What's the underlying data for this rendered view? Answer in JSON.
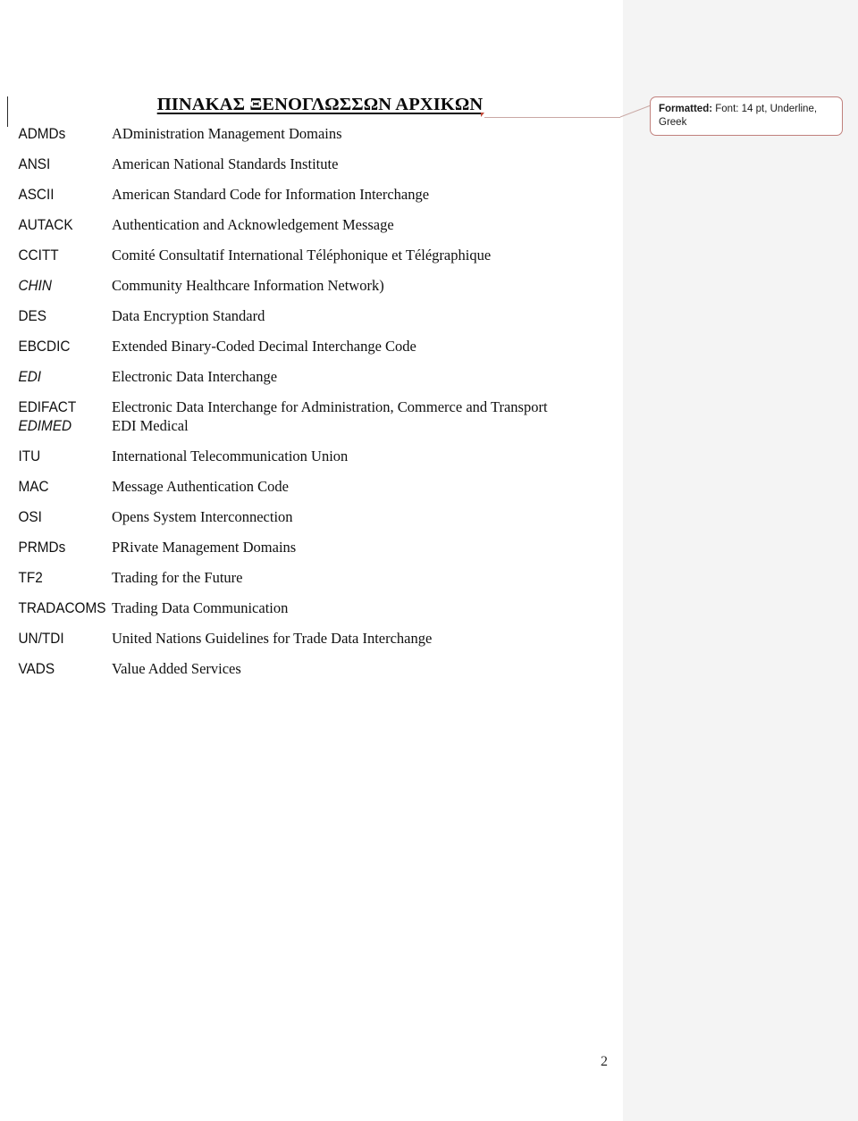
{
  "page": {
    "title": "ΠΙΝΑΚΑΣ ΞΕΝΟΓΛΩΣΣΩΝ ΑΡΧΙΚΩΝ",
    "number": "2",
    "sheet_color": "#ffffff",
    "margin_color": "#f4f4f4"
  },
  "comment": {
    "label": "Formatted:",
    "text": " Font: 14 pt, Underline, Greek",
    "border_color": "#c0807c",
    "anchor_color": "#c24a3a"
  },
  "glossary": {
    "rows": [
      {
        "abbr": "ADMDs",
        "italic": false,
        "definition": "ADministration Management Domains"
      },
      {
        "abbr": "ANSI",
        "italic": false,
        "definition": "American National Standards Institute"
      },
      {
        "abbr": "ASCII",
        "italic": false,
        "definition": "American Standard Code for Information Interchange"
      },
      {
        "abbr": "AUTACK",
        "italic": false,
        "definition": "Authentication and Acknowledgement Message"
      },
      {
        "abbr": "CCITT",
        "italic": false,
        "definition": "Comité Consultatif International Téléphonique et Télégraphique"
      },
      {
        "abbr": "CHIN",
        "italic": true,
        "definition": "Community Healthcare Information Network)"
      },
      {
        "abbr": "DES",
        "italic": false,
        "definition": "Data Encryption Standard"
      },
      {
        "abbr": "EBCDIC",
        "italic": false,
        "definition": "Extended Binary-Coded Decimal Interchange Code"
      },
      {
        "abbr": "EDI",
        "italic": true,
        "definition": "Electronic Data Interchange"
      },
      {
        "abbr": "EDIFACT",
        "italic": false,
        "definition": "Electronic Data Interchange for Administration, Commerce and Transport",
        "tight": true
      },
      {
        "abbr": "EDIMED",
        "italic": true,
        "definition": "EDI Medical"
      },
      {
        "abbr": "ITU",
        "italic": false,
        "definition": "International Telecommunication Union"
      },
      {
        "abbr": "MAC",
        "italic": false,
        "definition": "Message Authentication Code"
      },
      {
        "abbr": "OSI",
        "italic": false,
        "definition": "Opens System Interconnection"
      },
      {
        "abbr": "PRMDs",
        "italic": false,
        "definition": "PRivate Management Domains"
      },
      {
        "abbr": "TF2",
        "italic": false,
        "definition": "Trading for the Future"
      },
      {
        "abbr": "TRADACOMS",
        "italic": false,
        "definition": "Trading Data Communication"
      },
      {
        "abbr": "UN/TDI",
        "italic": false,
        "definition": "United Nations Guidelines for Trade Data Interchange"
      },
      {
        "abbr": "VADS",
        "italic": false,
        "definition": "Value Added Services"
      }
    ]
  }
}
